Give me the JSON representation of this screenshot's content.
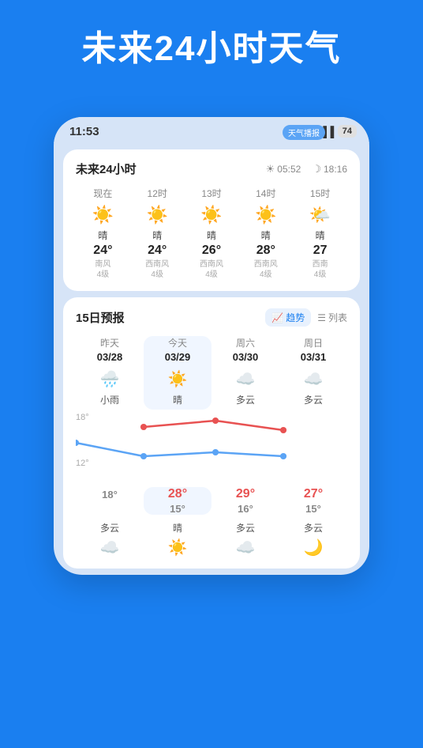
{
  "hero": {
    "title": "未来24小时天气"
  },
  "phone": {
    "statusBar": {
      "time": "11:53",
      "alertBadge": "天气播报",
      "battery": "74"
    },
    "card24h": {
      "title": "未来24小时",
      "sunrise": "05:52",
      "sunset": "18:16",
      "hours": [
        {
          "label": "现在",
          "icon": "☀️",
          "condition": "晴",
          "temp": "24°",
          "wind": "南风\n4级"
        },
        {
          "label": "12时",
          "icon": "☀️",
          "condition": "晴",
          "temp": "24°",
          "wind": "西南风\n4级"
        },
        {
          "label": "13时",
          "icon": "☀️",
          "condition": "晴",
          "temp": "26°",
          "wind": "西南风\n4级"
        },
        {
          "label": "14时",
          "icon": "☀️",
          "condition": "晴",
          "temp": "28°",
          "wind": "西南风\n4级"
        },
        {
          "label": "15时",
          "icon": "🌤️",
          "condition": "晴",
          "temp": "27",
          "wind": "西南\n4级"
        }
      ]
    },
    "card15d": {
      "title": "15日预报",
      "trendLabel": "趋势",
      "listLabel": "列表",
      "days": [
        {
          "name": "昨天",
          "date": "03/28",
          "iconType": "rain",
          "condition": "小雨",
          "high": "",
          "low": "18°",
          "today": false
        },
        {
          "name": "今天",
          "date": "03/29",
          "iconType": "sun",
          "condition": "晴",
          "high": "28°",
          "low": "15°",
          "today": true
        },
        {
          "name": "周六",
          "date": "03/30",
          "iconType": "cloud",
          "condition": "多云",
          "high": "29°",
          "low": "16°",
          "today": false
        },
        {
          "name": "周日",
          "date": "03/31",
          "iconType": "cloud",
          "condition": "多云",
          "high": "27°",
          "low": "15°",
          "today": false
        }
      ],
      "chartLeftLabels": {
        "top": "18°",
        "bottom": "12°"
      },
      "bottomRow": [
        {
          "condition": "多云",
          "iconType": "cloud"
        },
        {
          "condition": "晴",
          "iconType": "sun"
        },
        {
          "condition": "多云",
          "iconType": "cloud"
        },
        {
          "condition": "多云",
          "iconType": "moon"
        }
      ]
    }
  }
}
